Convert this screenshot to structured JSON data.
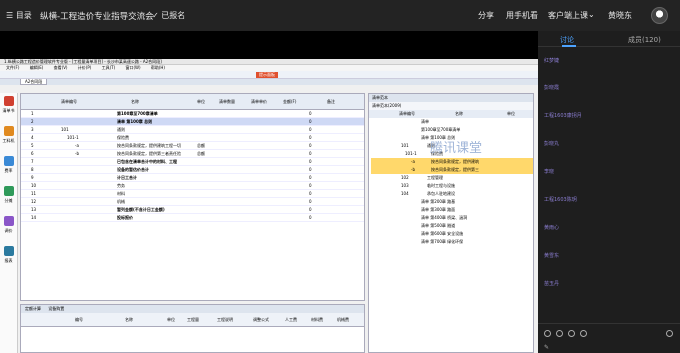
{
  "topbar": {
    "menu": "目录",
    "title": "纵横-工程造价专业指导交流会",
    "signup": "已报名",
    "share": "分享",
    "mobile": "用手机看",
    "client": "客户端上课",
    "user": "黄晓东"
  },
  "app": {
    "titlebar": "1.纵横公路工程造价管理软件专业版 - [工程量清单项目] - 长沙市某高速公路 - A2合同段]",
    "menu": [
      "文件(F)",
      "编辑(E)",
      "查看(V)",
      "计价(P)",
      "工具(T)",
      "窗口(W)",
      "帮助(H)"
    ],
    "tab": "A2合同段",
    "red_btn": "提示面板",
    "left_nav": [
      {
        "label": "清单书",
        "color": "#d04030"
      },
      {
        "label": "工料机",
        "color": "#e08a20"
      },
      {
        "label": "费率",
        "color": "#3b8ad6"
      },
      {
        "label": "分摊",
        "color": "#2f9a5a"
      },
      {
        "label": "调价",
        "color": "#8a56c8"
      },
      {
        "label": "报表",
        "color": "#2b7a9f"
      }
    ],
    "grid_headers": [
      "清单编号",
      "名称",
      "单位",
      "清单数量",
      "清单单价",
      "金额(F)",
      "备注"
    ],
    "grid_rows": [
      {
        "no": "1",
        "code": "",
        "name": "第100章至700章清单",
        "qty": "",
        "amt": "0"
      },
      {
        "no": "2",
        "code": "",
        "name": "清单 第100章 总则",
        "qty": "",
        "amt": "0"
      },
      {
        "no": "3",
        "code": "101",
        "name": "通则",
        "qty": "",
        "amt": "0"
      },
      {
        "no": "4",
        "code": "101-1",
        "name": "保险费",
        "qty": "",
        "amt": "0"
      },
      {
        "no": "5",
        "code": "-a",
        "name": "按合同条款规定，提供建筑工程一切",
        "qty": "总额",
        "amt": "0"
      },
      {
        "no": "6",
        "code": "-b",
        "name": "按合同条款规定，提供第三者责任险",
        "qty": "总额",
        "amt": "0"
      },
      {
        "no": "7",
        "code": "",
        "name": "已包含在清单合计中的材料、工程",
        "qty": "",
        "amt": "0"
      },
      {
        "no": "8",
        "code": "",
        "name": "设备的暂估价合计",
        "qty": "",
        "amt": "0"
      },
      {
        "no": "9",
        "code": "",
        "name": "计日工合计",
        "qty": "",
        "amt": "0"
      },
      {
        "no": "10",
        "code": "",
        "name": "劳务",
        "qty": "",
        "amt": "0"
      },
      {
        "no": "11",
        "code": "",
        "name": "材料",
        "qty": "",
        "amt": "0"
      },
      {
        "no": "12",
        "code": "",
        "name": "机械",
        "qty": "",
        "amt": "0"
      },
      {
        "no": "13",
        "code": "",
        "name": "暂列金额(不含计日工金额)",
        "qty": "",
        "amt": "0"
      },
      {
        "no": "14",
        "code": "",
        "name": "投标报价",
        "qty": "",
        "amt": "0"
      }
    ],
    "bottom_tabs": [
      "定额计算",
      "设备购置"
    ],
    "bottom_headers": [
      "编号",
      "名称",
      "单位",
      "工程量",
      "工程说明",
      "调整公式",
      "人工费",
      "材料费",
      "机械费"
    ],
    "right_title": "清单范本",
    "right_filter": "清单范本(2009)",
    "right_cols": [
      "清单编号",
      "名称",
      "单位"
    ],
    "right_rows": [
      {
        "code": "",
        "name": "清单",
        "hl": false
      },
      {
        "code": "",
        "name": "第100章至700章清单",
        "hl": false
      },
      {
        "code": "",
        "name": "清单 第100章 总则",
        "hl": false
      },
      {
        "code": "101",
        "name": "通则",
        "hl": false
      },
      {
        "code": "101-1",
        "name": "保险费",
        "hl": false
      },
      {
        "code": "-a",
        "name": "按合同条款规定，提供建筑",
        "hl": true
      },
      {
        "code": "-b",
        "name": "按合同条款规定，提供第三",
        "hl": true
      },
      {
        "code": "102",
        "name": "工程管理",
        "hl": false
      },
      {
        "code": "103",
        "name": "临时工程与设施",
        "hl": false
      },
      {
        "code": "104",
        "name": "承包人驻地建设",
        "hl": false
      },
      {
        "code": "",
        "name": "清单 第200章 路基",
        "hl": false
      },
      {
        "code": "",
        "name": "清单 第300章 路面",
        "hl": false
      },
      {
        "code": "",
        "name": "清单 第400章 桥梁、涵洞",
        "hl": false
      },
      {
        "code": "",
        "name": "清单 第500章 隧道",
        "hl": false
      },
      {
        "code": "",
        "name": "清单 第600章 安全设施",
        "hl": false
      },
      {
        "code": "",
        "name": "清单 第700章 绿化环保",
        "hl": false
      }
    ],
    "watermark": "腾讯课堂"
  },
  "sidebar": {
    "tab_discuss": "讨论",
    "tab_members": "成员(120)",
    "messages": [
      "红梦婕",
      "彭晓霞",
      "工程1603康拐月",
      "彭晓丸",
      "李晓",
      "工程1603陈玥",
      "黄雨心",
      "黄雪东",
      "苗玉丹"
    ]
  }
}
